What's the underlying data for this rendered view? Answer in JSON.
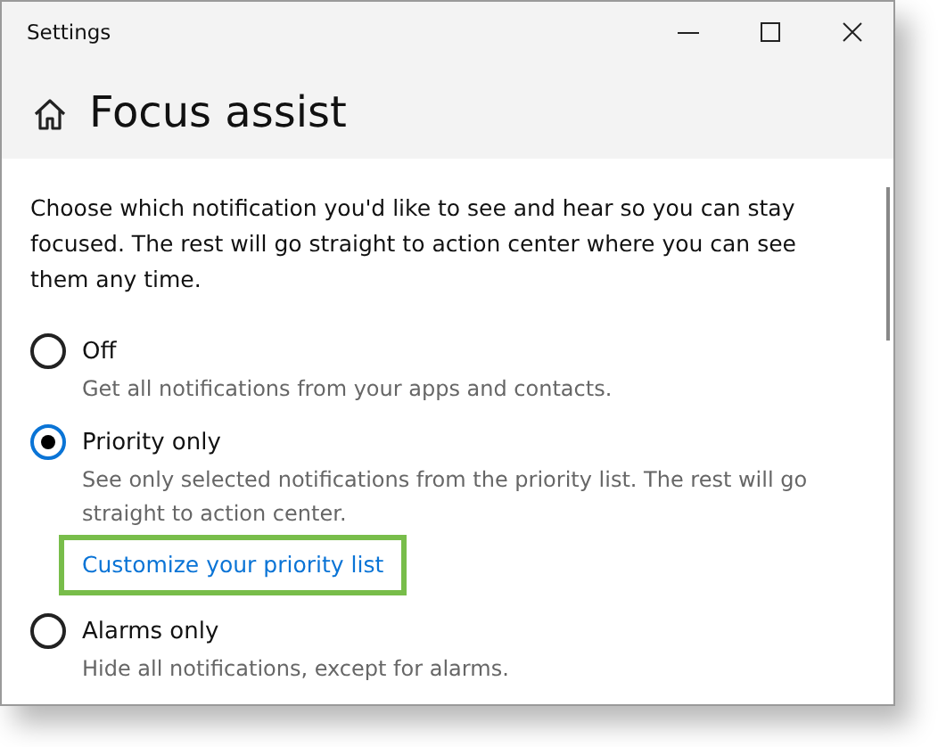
{
  "window": {
    "title": "Settings"
  },
  "header": {
    "title": "Focus assist"
  },
  "intro": "Choose which notification you'd like to see and hear so you can stay focused. The rest will go straight to action center where you can see them any time.",
  "options": [
    {
      "label": "Off",
      "description": "Get all notifications from your apps and contacts.",
      "selected": false
    },
    {
      "label": "Priority only",
      "description": "See only selected notifications from the priority list. The rest will go straight to action center.",
      "selected": true,
      "link": {
        "label": "Customize your priority list",
        "highlighted": true
      }
    },
    {
      "label": "Alarms only",
      "description": "Hide all notifications, except for alarms.",
      "selected": false
    }
  ]
}
